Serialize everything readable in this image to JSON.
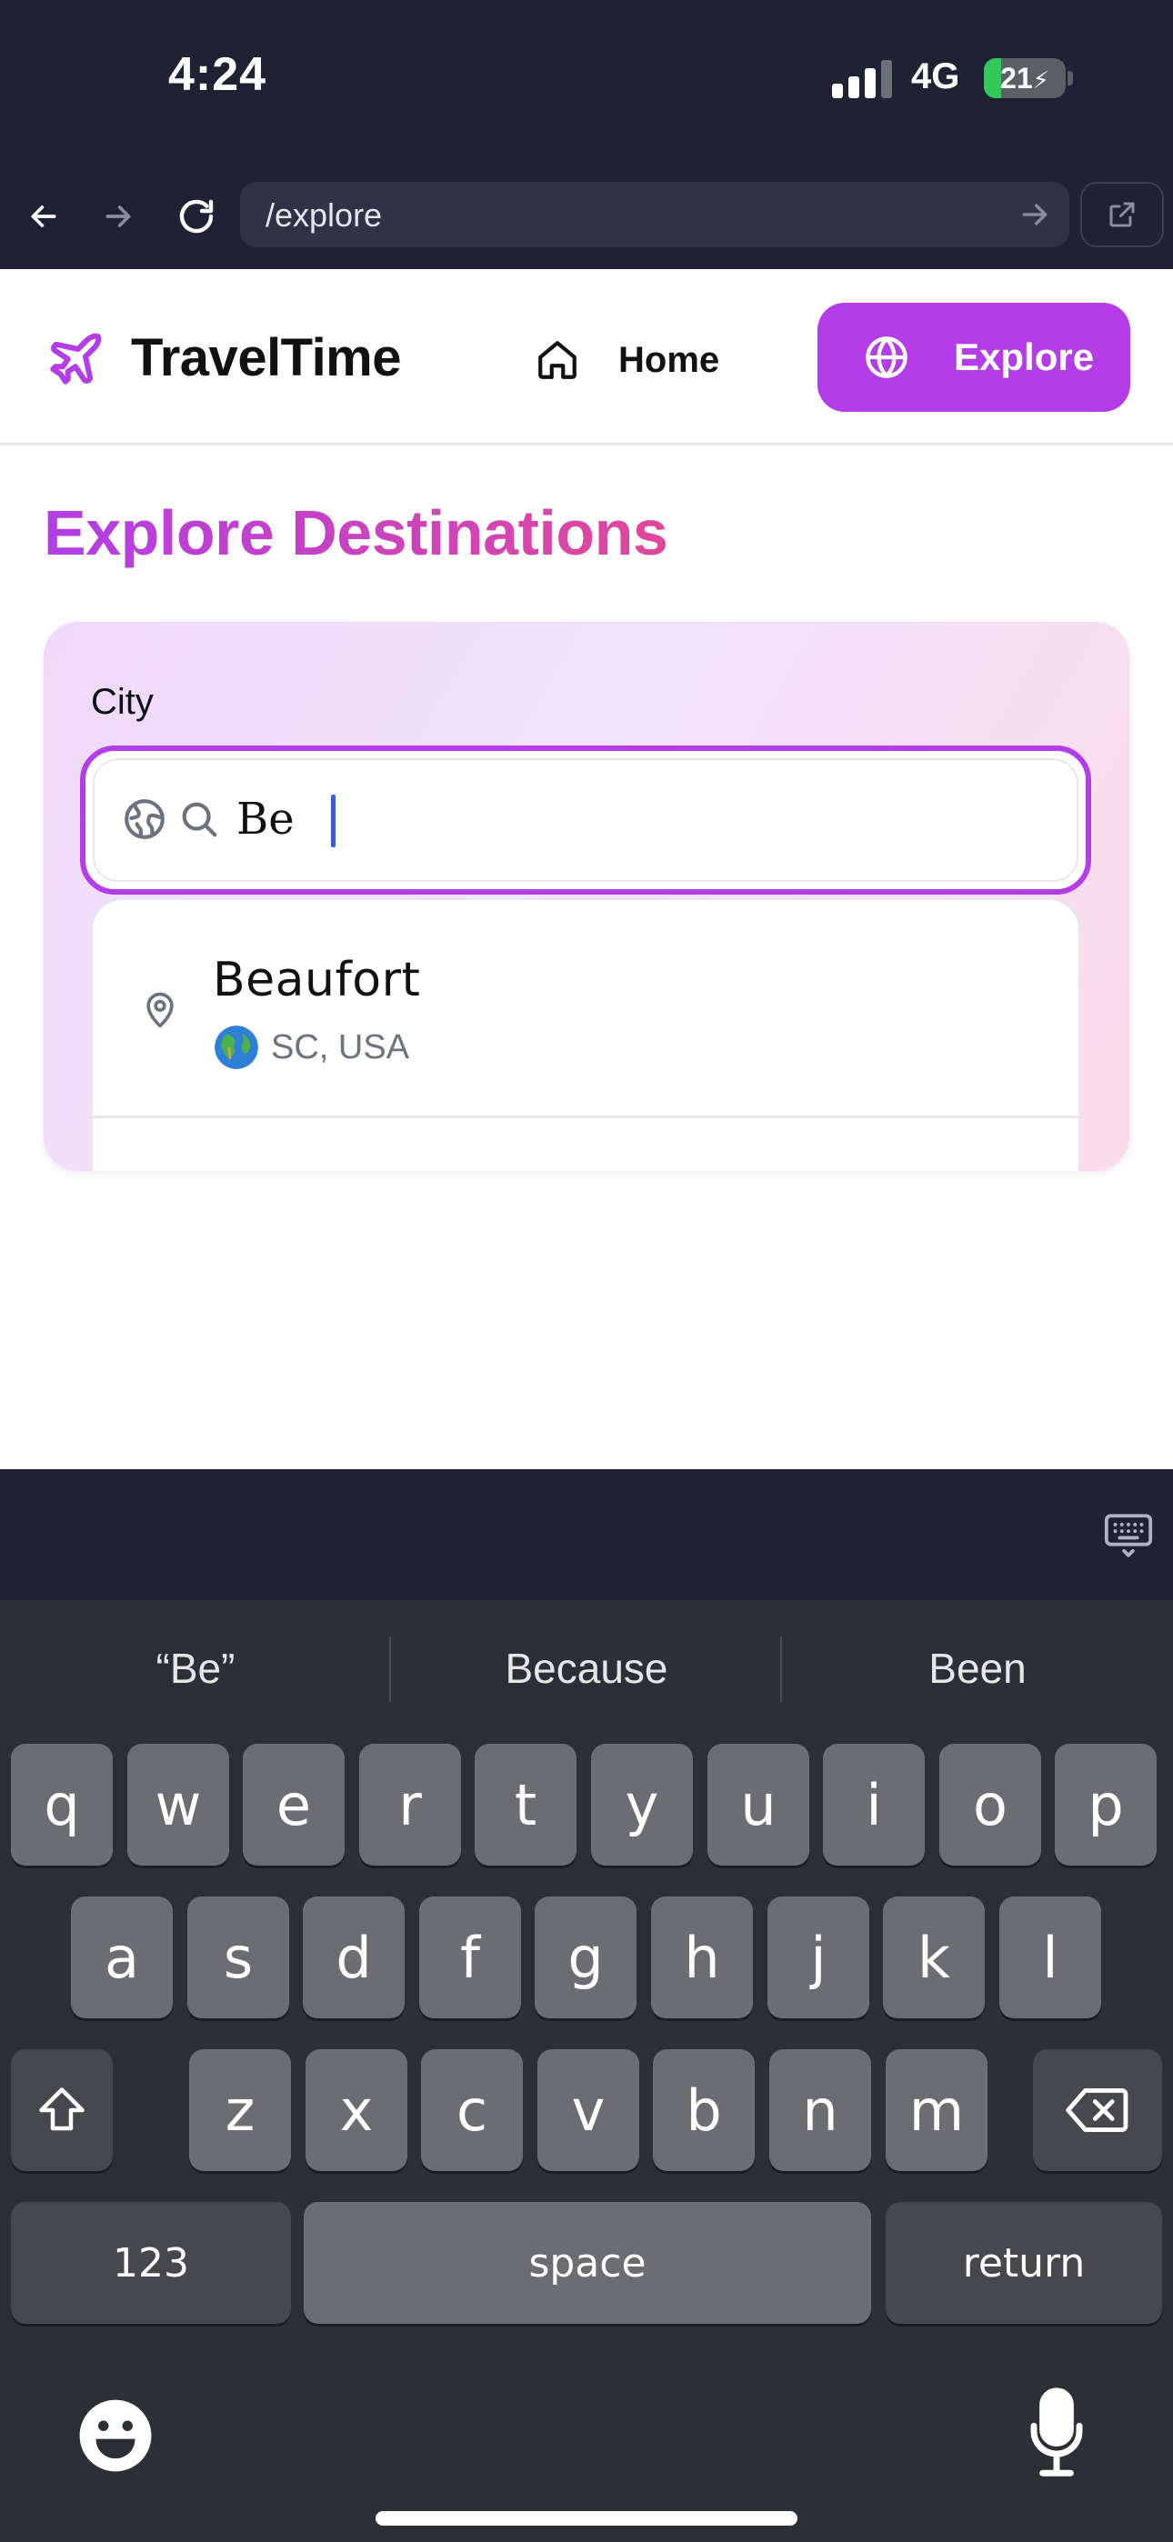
{
  "status_bar": {
    "time": "4:24",
    "network": "4G",
    "battery": "21",
    "battery_level_percent": 21
  },
  "browser": {
    "url": "/explore",
    "back_icon": "arrow-left-icon",
    "forward_icon": "arrow-right-icon",
    "reload_icon": "reload-icon",
    "open_external_icon": "external-link-icon"
  },
  "header": {
    "brand": "TravelTime",
    "logo_icon": "plane-icon",
    "nav": {
      "home_label": "Home",
      "explore_label": "Explore"
    }
  },
  "main": {
    "title": "Explore Destinations",
    "search": {
      "label": "City",
      "value": "Be",
      "placeholder": ""
    },
    "suggestions": [
      {
        "name": "Beaufort",
        "flag": "🌍",
        "region": "SC, USA"
      }
    ]
  },
  "keyboard": {
    "suggestions": [
      "“Be”",
      "Because",
      "Been"
    ],
    "row1": [
      "q",
      "w",
      "e",
      "r",
      "t",
      "y",
      "u",
      "i",
      "o",
      "p"
    ],
    "row2": [
      "a",
      "s",
      "d",
      "f",
      "g",
      "h",
      "j",
      "k",
      "l"
    ],
    "row3": [
      "z",
      "x",
      "c",
      "v",
      "b",
      "n",
      "m"
    ],
    "numbers_label": "123",
    "space_label": "space",
    "return_label": "return"
  },
  "colors": {
    "accent": "#b43de8",
    "title_gradient_start": "#b13ee6",
    "title_gradient_end": "#e0489a",
    "chrome_background": "#1e2232",
    "keyboard_background": "#2c2f37",
    "key_background": "#6b6d73",
    "caret": "#3b5bdb"
  }
}
